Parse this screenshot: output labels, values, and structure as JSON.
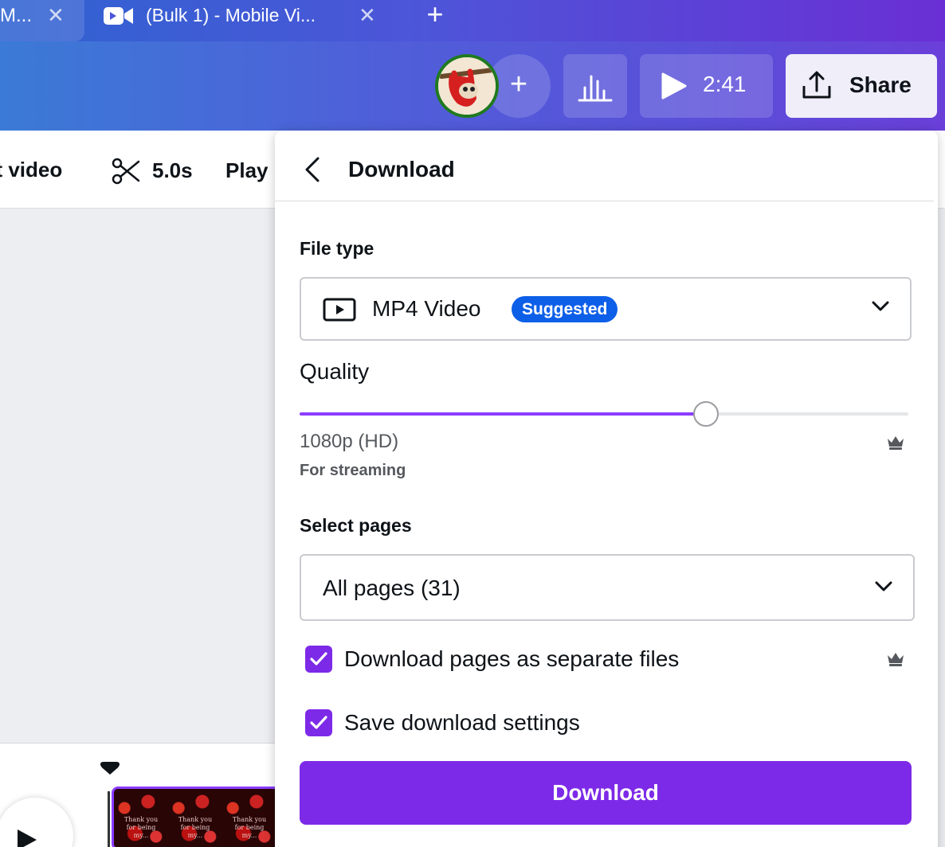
{
  "browser": {
    "tabs": [
      {
        "title": "M...",
        "active": false
      },
      {
        "title": "(Bulk 1) - Mobile Vi...",
        "active": true
      }
    ],
    "close_glyph": "✕",
    "new_tab_glyph": "+"
  },
  "header": {
    "add_collaborator_glyph": "+",
    "present_time": "2:41",
    "share_label": "Share"
  },
  "toolbar": {
    "edit_label": "lit video",
    "duration": "5.0s",
    "playback_label": "Play"
  },
  "clip_caption": "Thank you\nfor being\nmy...",
  "download_panel": {
    "title": "Download",
    "file_type_label": "File type",
    "file_type_value": "MP4 Video",
    "file_type_badge": "Suggested",
    "quality_label": "Quality",
    "quality_fraction": 0.667,
    "quality_value": "1080p (HD)",
    "quality_hint": "For streaming",
    "select_pages_label": "Select pages",
    "select_pages_value": "All pages (31)",
    "separate_files_label": "Download pages as separate files",
    "separate_files_checked": true,
    "save_settings_label": "Save download settings",
    "save_settings_checked": true,
    "download_button": "Download"
  },
  "colors": {
    "accent": "#7d2ae8",
    "badge": "#0d5fe8"
  }
}
